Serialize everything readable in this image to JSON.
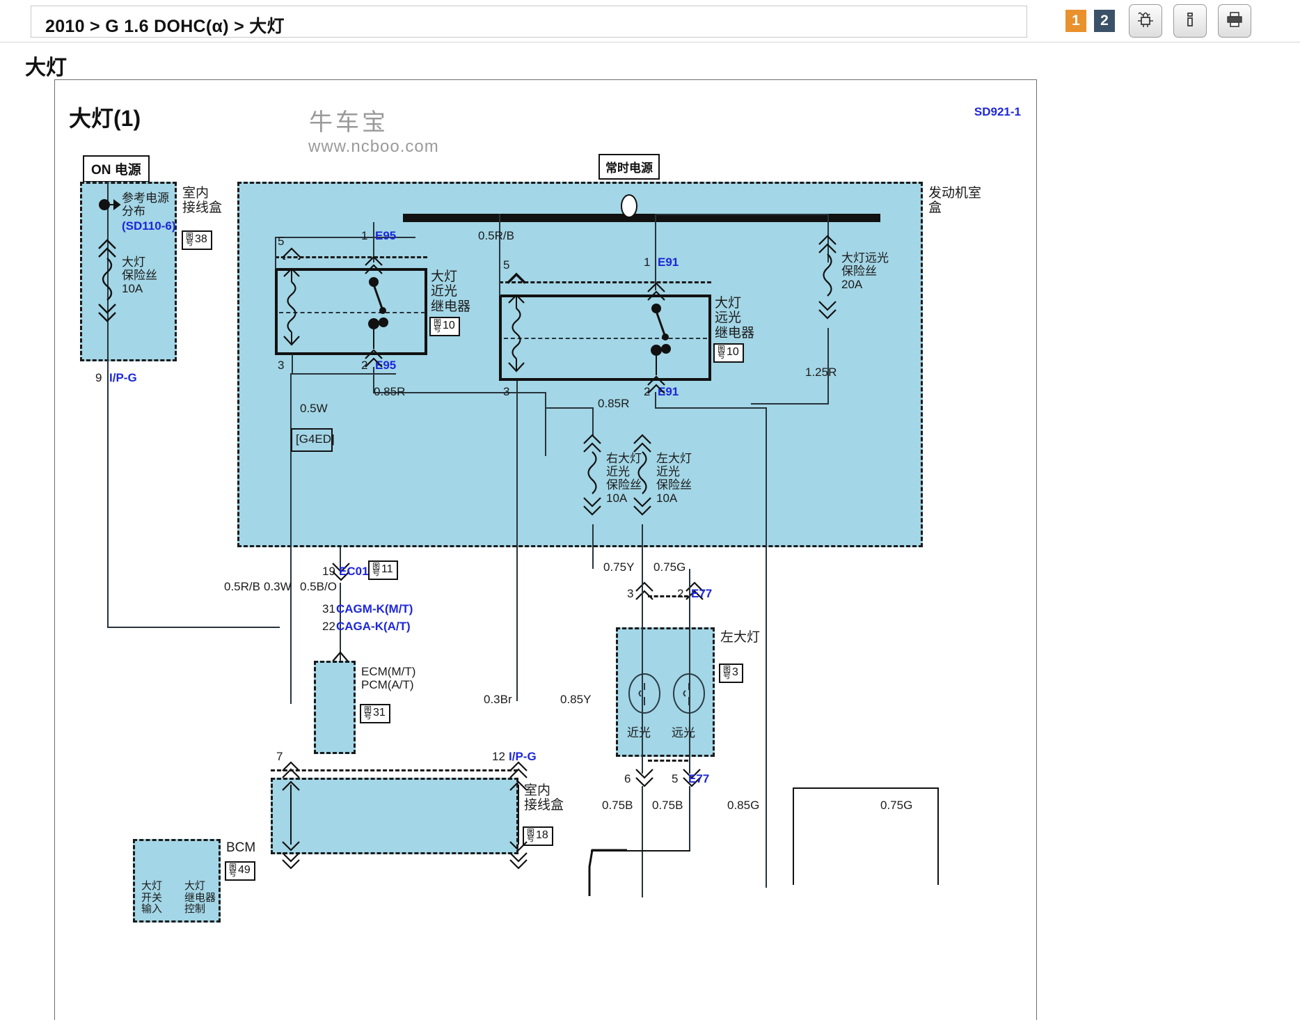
{
  "topbar": {
    "breadcrumb": "2010 > G 1.6 DOHC(α) > 大灯",
    "page_tabs": [
      {
        "label": "1",
        "color": "#e8912d",
        "active": true
      },
      {
        "label": "2",
        "color": "#3b5168",
        "active": false
      }
    ],
    "tools": [
      {
        "name": "circuit-view-icon",
        "title": "电路"
      },
      {
        "name": "info-icon",
        "title": "信息"
      },
      {
        "name": "print-icon",
        "title": "打印"
      }
    ]
  },
  "page": {
    "title": "大灯",
    "diagram_title": "大灯(1)",
    "sheet_code": "SD921-1",
    "watermark_cn": "牛车宝",
    "watermark_url": "www.ncboo.com"
  },
  "diagram": {
    "power_labels": {
      "on_power": "ON 电源",
      "constant_power": "常时电源"
    },
    "boxes": {
      "indoor_junction_top": {
        "name": "室内\n接线盒",
        "fig": "38"
      },
      "engine_room": "发动机室\n盒",
      "ecm": {
        "name": "ECM(M/T)\nPCM(A/T)",
        "fig": "31"
      },
      "bcm": {
        "name": "BCM",
        "fig": "49",
        "left_text": "大灯\n开关\n输入",
        "right_text": "大灯\n继电器\n控制"
      },
      "left_headlamp": {
        "name": "左大灯",
        "fig": "3",
        "low_beam": "近光",
        "high_beam": "远光"
      },
      "indoor_junction_bottom": {
        "name": "室内\n接线盒",
        "fig": "18"
      }
    },
    "reference_power": {
      "text": "参考电源\n分布",
      "code": "(SD110-6)"
    },
    "fuses": [
      {
        "name": "大灯\n保险丝\n10A"
      },
      {
        "name": "大灯远光\n保险丝\n20A"
      },
      {
        "name": "右大灯\n近光\n保险丝\n10A"
      },
      {
        "name": "左大灯\n近光\n保险丝\n10A"
      }
    ],
    "relays": [
      {
        "name": "大灯\n近光\n继电器",
        "fig": "10",
        "pins": [
          "5",
          "1",
          "3",
          "2"
        ],
        "connector": "E95"
      },
      {
        "name": "大灯\n远光\n继电器",
        "fig": "10",
        "pins": [
          "5",
          "1",
          "3",
          "2"
        ],
        "connector": "E91"
      }
    ],
    "connectors": [
      {
        "pin": "9",
        "code": "I/P-G"
      },
      {
        "pin": "1",
        "code": "E95"
      },
      {
        "pin": "2",
        "code": "E95"
      },
      {
        "pin": "1",
        "code": "E91"
      },
      {
        "pin": "2",
        "code": "E91"
      },
      {
        "pin": "19",
        "code": "EC01",
        "fig": "11"
      },
      {
        "pin": "31",
        "code": "CAGM-K(M/T)"
      },
      {
        "pin": "22",
        "code": "CAGA-K(A/T)"
      },
      {
        "pin": "3",
        "code": ""
      },
      {
        "pin": "2",
        "code": "E77"
      },
      {
        "pin": "6",
        "code": ""
      },
      {
        "pin": "5",
        "code": "E77"
      },
      {
        "pin": "7",
        "code": ""
      },
      {
        "pin": "12",
        "code": "I/P-G"
      }
    ],
    "wire_labels": [
      "0.5R/B",
      "0.5W",
      "[G4ED]",
      "0.85R",
      "0.85R",
      "1.25R",
      "0.5R/B",
      "0.3W",
      "0.5B/O",
      "0.75Y",
      "0.75G",
      "0.3Br",
      "0.85Y",
      "0.75B",
      "0.75B",
      "0.85G",
      "0.75G"
    ],
    "pin_numbers_top": [
      "5",
      "1",
      "3",
      "2",
      "5",
      "1",
      "3",
      "2"
    ]
  }
}
